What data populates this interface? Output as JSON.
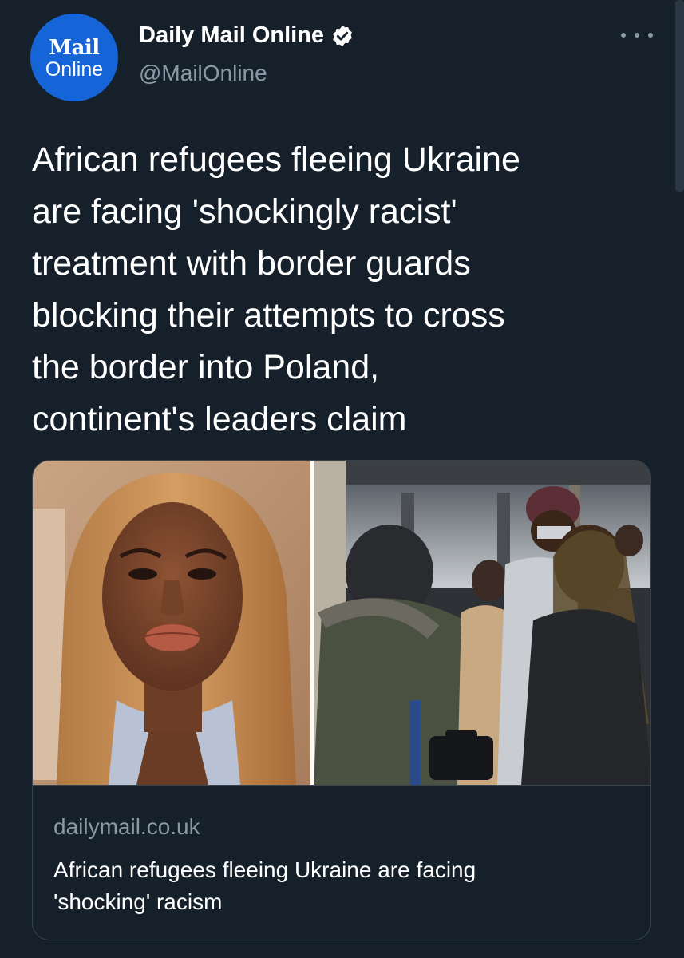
{
  "account": {
    "logo_top": "Mail",
    "logo_bottom": "Online",
    "display_name": "Daily Mail Online",
    "handle": "@MailOnline",
    "verified": true
  },
  "tweet": {
    "text_lines": [
      "African refugees fleeing Ukraine",
      "are facing 'shockingly racist'",
      "treatment with border guards",
      "blocking their attempts to cross",
      "the border into Poland,",
      "continent's leaders claim"
    ]
  },
  "card": {
    "domain": "dailymail.co.uk",
    "title_lines": [
      "African refugees fleeing Ukraine are facing",
      "'shocking' racism"
    ]
  },
  "icons": {
    "verified": "verified-badge-icon",
    "more": "more-options-icon"
  },
  "colors": {
    "background": "#15202b",
    "brand_blue": "#1565d8",
    "secondary_text": "#8b98a5",
    "border": "#38444d"
  }
}
